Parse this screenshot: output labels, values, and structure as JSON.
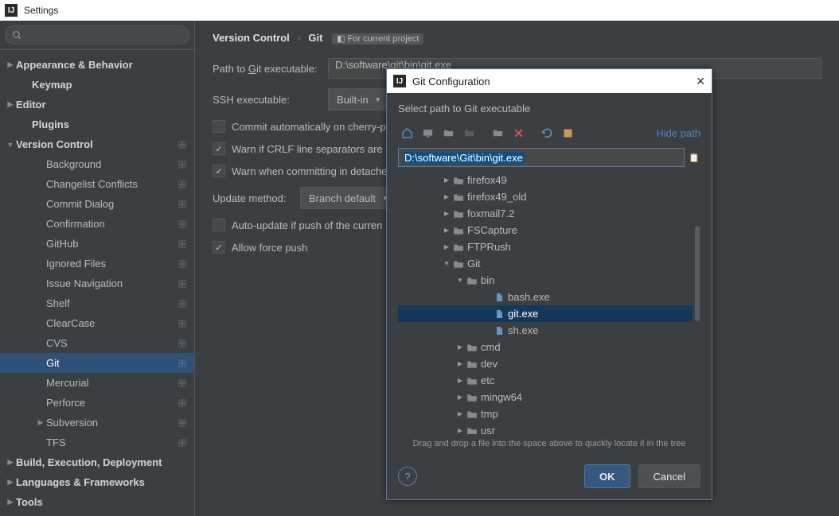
{
  "window": {
    "title": "Settings",
    "app_icon": "IJ"
  },
  "sidebar": {
    "search_ph": "",
    "items": [
      {
        "label": "Appearance & Behavior",
        "lvl": "lvl0",
        "caret": "▶",
        "cfg": false
      },
      {
        "label": "Keymap",
        "lvl": "lvl1n",
        "caret": "",
        "cfg": false
      },
      {
        "label": "Editor",
        "lvl": "lvl0",
        "caret": "▶",
        "cfg": false
      },
      {
        "label": "Plugins",
        "lvl": "lvl1n",
        "caret": "",
        "cfg": false
      },
      {
        "label": "Version Control",
        "lvl": "lvl0",
        "caret": "▼",
        "cfg": true
      },
      {
        "label": "Background",
        "lvl": "lvl2",
        "caret": "",
        "cfg": true
      },
      {
        "label": "Changelist Conflicts",
        "lvl": "lvl2",
        "caret": "",
        "cfg": true
      },
      {
        "label": "Commit Dialog",
        "lvl": "lvl2",
        "caret": "",
        "cfg": true
      },
      {
        "label": "Confirmation",
        "lvl": "lvl2",
        "caret": "",
        "cfg": true
      },
      {
        "label": "GitHub",
        "lvl": "lvl2",
        "caret": "",
        "cfg": true
      },
      {
        "label": "Ignored Files",
        "lvl": "lvl2",
        "caret": "",
        "cfg": true
      },
      {
        "label": "Issue Navigation",
        "lvl": "lvl2",
        "caret": "",
        "cfg": true
      },
      {
        "label": "Shelf",
        "lvl": "lvl2",
        "caret": "",
        "cfg": true
      },
      {
        "label": "ClearCase",
        "lvl": "lvl2",
        "caret": "",
        "cfg": true
      },
      {
        "label": "CVS",
        "lvl": "lvl2",
        "caret": "",
        "cfg": true
      },
      {
        "label": "Git",
        "lvl": "lvl2",
        "caret": "",
        "cfg": true,
        "sel": true
      },
      {
        "label": "Mercurial",
        "lvl": "lvl2",
        "caret": "",
        "cfg": true
      },
      {
        "label": "Perforce",
        "lvl": "lvl2",
        "caret": "",
        "cfg": true
      },
      {
        "label": "Subversion",
        "lvl": "lvl2",
        "caret": "▶",
        "cfg": true
      },
      {
        "label": "TFS",
        "lvl": "lvl2",
        "caret": "",
        "cfg": true
      },
      {
        "label": "Build, Execution, Deployment",
        "lvl": "lvl0",
        "caret": "▶",
        "cfg": false
      },
      {
        "label": "Languages & Frameworks",
        "lvl": "lvl0",
        "caret": "▶",
        "cfg": false
      },
      {
        "label": "Tools",
        "lvl": "lvl0",
        "caret": "▶",
        "cfg": false
      }
    ]
  },
  "crumb": {
    "a": "Version Control",
    "b": "Git",
    "scope": "For current project"
  },
  "form": {
    "path_label_pre": "Path to ",
    "path_label_u": "G",
    "path_label_post": "it executable:",
    "path_value": "D:\\software\\git\\bin\\git.exe",
    "ssh_label": "SSH executable:",
    "ssh_value": "Built-in",
    "ck1": "Commit automatically on cherry-p",
    "ck2_pre": "Warn if ",
    "ck2_u": "C",
    "ck2_post": "RLF line separators are a",
    "ck3": "Warn when committing in detache",
    "upd_label": "Update method:",
    "upd_value": "Branch default",
    "ck4": "Auto-update if push of the curren",
    "ck5": "Allow force push"
  },
  "dialog": {
    "title": "Git Configuration",
    "app_icon": "IJ",
    "subtitle": "Select path to Git executable",
    "hide": "Hide path",
    "path": "D:\\software\\Git\\bin\\git.exe",
    "tree": [
      {
        "d": "d3",
        "c": "▶",
        "t": "folder",
        "label": "firefox49"
      },
      {
        "d": "d3",
        "c": "▶",
        "t": "folder",
        "label": "firefox49_old"
      },
      {
        "d": "d3",
        "c": "▶",
        "t": "folder",
        "label": "foxmail7.2"
      },
      {
        "d": "d3",
        "c": "▶",
        "t": "folder",
        "label": "FSCapture"
      },
      {
        "d": "d3",
        "c": "▶",
        "t": "folder",
        "label": "FTPRush"
      },
      {
        "d": "d3",
        "c": "▼",
        "t": "folder",
        "label": "Git"
      },
      {
        "d": "d4",
        "c": "▼",
        "t": "folder",
        "label": "bin"
      },
      {
        "d": "d6",
        "c": "",
        "t": "file",
        "label": "bash.exe"
      },
      {
        "d": "d6",
        "c": "",
        "t": "file",
        "label": "git.exe",
        "sel": true
      },
      {
        "d": "d6",
        "c": "",
        "t": "file",
        "label": "sh.exe"
      },
      {
        "d": "d4",
        "c": "▶",
        "t": "folder",
        "label": "cmd"
      },
      {
        "d": "d4",
        "c": "▶",
        "t": "folder",
        "label": "dev"
      },
      {
        "d": "d4",
        "c": "▶",
        "t": "folder",
        "label": "etc"
      },
      {
        "d": "d4",
        "c": "▶",
        "t": "folder",
        "label": "mingw64"
      },
      {
        "d": "d4",
        "c": "▶",
        "t": "folder",
        "label": "tmp"
      },
      {
        "d": "d4",
        "c": "▶",
        "t": "folder",
        "label": "usr"
      }
    ],
    "hint": "Drag and drop a file into the space above to quickly locate it in the tree",
    "ok": "OK",
    "cancel": "Cancel"
  }
}
